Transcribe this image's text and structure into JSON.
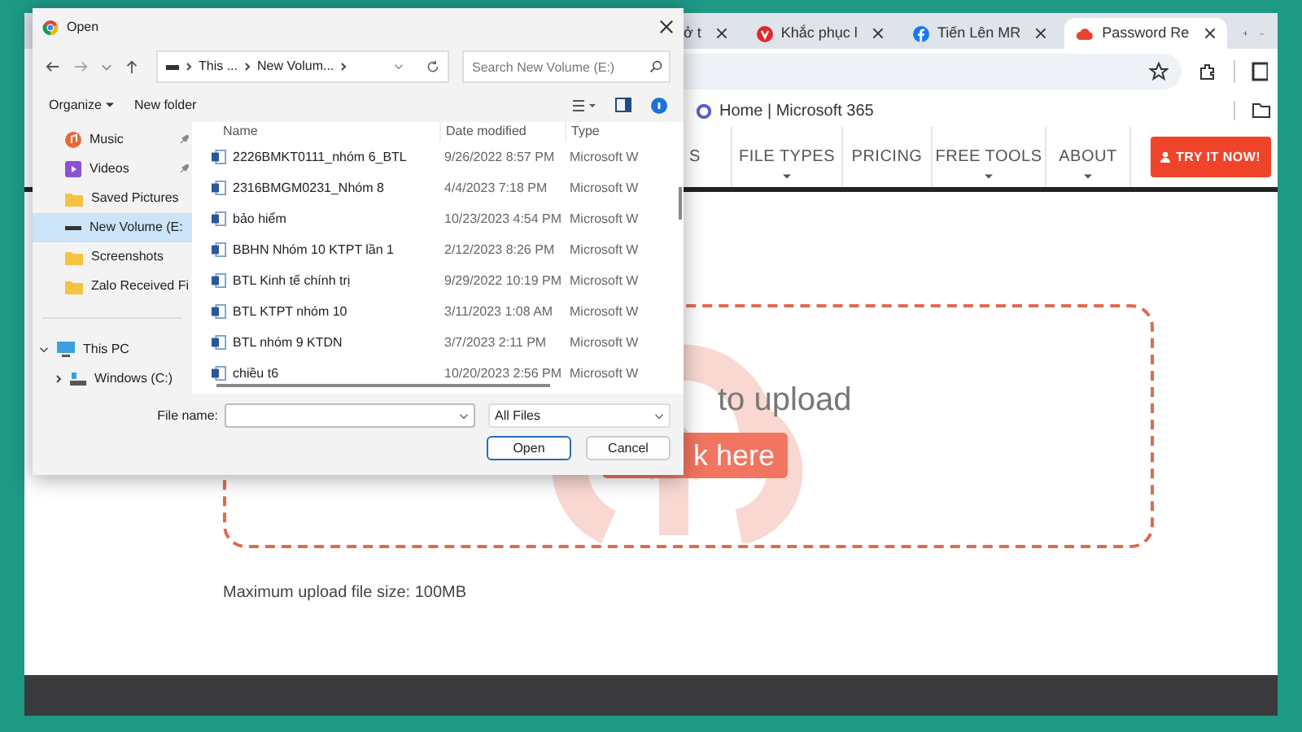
{
  "browser": {
    "tabs": [
      {
        "title": "ở t",
        "kind": "plain",
        "selected": false
      },
      {
        "title": "Khắc phục l",
        "kind": "vivaldi",
        "selected": false
      },
      {
        "title": "Tiến Lên MR",
        "kind": "facebook",
        "selected": false
      },
      {
        "title": "Password Re",
        "kind": "cloud",
        "selected": true
      }
    ],
    "bookmarks": [
      {
        "title": "Home | Microsoft 365"
      }
    ]
  },
  "site": {
    "nav": [
      {
        "label": "S",
        "dropdown": false
      },
      {
        "label": "FILE TYPES",
        "dropdown": true
      },
      {
        "label": "PRICING",
        "dropdown": false
      },
      {
        "label": "FREE TOOLS",
        "dropdown": true
      },
      {
        "label": "ABOUT",
        "dropdown": true
      }
    ],
    "cta": "TRY IT NOW!",
    "upload_prompt": "to upload",
    "upload_button": "k here",
    "max_size": "Maximum upload file size: 100MB"
  },
  "dialog": {
    "title": "Open",
    "breadcrumb": [
      "This ...",
      "New Volum..."
    ],
    "search": {
      "placeholder": "Search New Volume (E:)"
    },
    "toolbar": [
      {
        "label": "Organize",
        "dropdown": true
      },
      {
        "label": "New folder",
        "dropdown": false
      }
    ],
    "sidebar": [
      {
        "label": "Music",
        "kind": "music",
        "pinned": true,
        "selected": false
      },
      {
        "label": "Videos",
        "kind": "videos",
        "pinned": true,
        "selected": false
      },
      {
        "label": "Saved Pictures",
        "kind": "folder",
        "pinned": false,
        "selected": false
      },
      {
        "label": "New Volume (E:",
        "kind": "drive",
        "pinned": false,
        "selected": true
      },
      {
        "label": "Screenshots",
        "kind": "folder",
        "pinned": false,
        "selected": false
      },
      {
        "label": "Zalo Received Fi",
        "kind": "folder",
        "pinned": false,
        "selected": false
      },
      {
        "label": "This PC",
        "kind": "pc",
        "selected": false,
        "expanded": true,
        "children": [
          {
            "label": "Windows (C:)",
            "kind": "windrive",
            "selected": false,
            "expanded": false
          }
        ]
      }
    ],
    "columns": [
      "Name",
      "Date modified",
      "Type"
    ],
    "files": [
      {
        "name": "2226BMKT0111_nhóm 6_BTL",
        "date": "9/26/2022 8:57 PM",
        "type": "Microsoft W"
      },
      {
        "name": "2316BMGM0231_Nhóm 8",
        "date": "4/4/2023 7:18 PM",
        "type": "Microsoft W"
      },
      {
        "name": "bảo hiểm",
        "date": "10/23/2023 4:54 PM",
        "type": "Microsoft W"
      },
      {
        "name": "BBHN Nhóm 10 KTPT lần 1",
        "date": "2/12/2023 8:26 PM",
        "type": "Microsoft W"
      },
      {
        "name": "BTL Kinh tế chính trị",
        "date": "9/29/2022 10:19 PM",
        "type": "Microsoft W"
      },
      {
        "name": "BTL KTPT nhóm 10",
        "date": "3/11/2023 1:08 AM",
        "type": "Microsoft W"
      },
      {
        "name": "BTL nhóm 9 KTDN",
        "date": "3/7/2023 2:11 PM",
        "type": "Microsoft W"
      },
      {
        "name": "chiều t6",
        "date": "10/20/2023 2:56 PM",
        "type": "Microsoft W"
      }
    ],
    "file_name_label": "File name:",
    "file_type": "All Files",
    "buttons": [
      "Open",
      "Cancel"
    ]
  }
}
